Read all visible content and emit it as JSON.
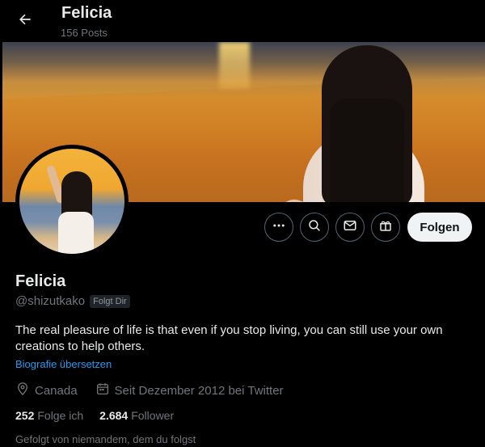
{
  "header": {
    "back_icon": "back-arrow-icon",
    "title": "Felicia",
    "posts_count": "156 Posts"
  },
  "profile": {
    "name": "Felicia",
    "handle": "@shizutkako",
    "follows_you_badge": "Folgt Dir",
    "bio": "The real pleasure of life is that even if you stop living, you can still use your own creations to help others.",
    "translate_link": "Biografie übersetzen",
    "location": "Canada",
    "joined": "Seit Dezember 2012 bei Twitter",
    "following_count": "252",
    "following_label": "Folge ich",
    "followers_count": "2.684",
    "followers_label": "Follower",
    "followed_by": "Gefolgt von niemandem, dem du folgst"
  },
  "actions": {
    "more_icon": "more-dots-icon",
    "search_icon": "search-icon",
    "message_icon": "mail-icon",
    "gift_icon": "gift-icon",
    "follow_label": "Folgen"
  },
  "colors": {
    "background": "#000000",
    "text_primary": "#e7e9ea",
    "text_secondary": "#71767b",
    "link": "#1d9bf0",
    "button_light": "#eff3f4"
  }
}
